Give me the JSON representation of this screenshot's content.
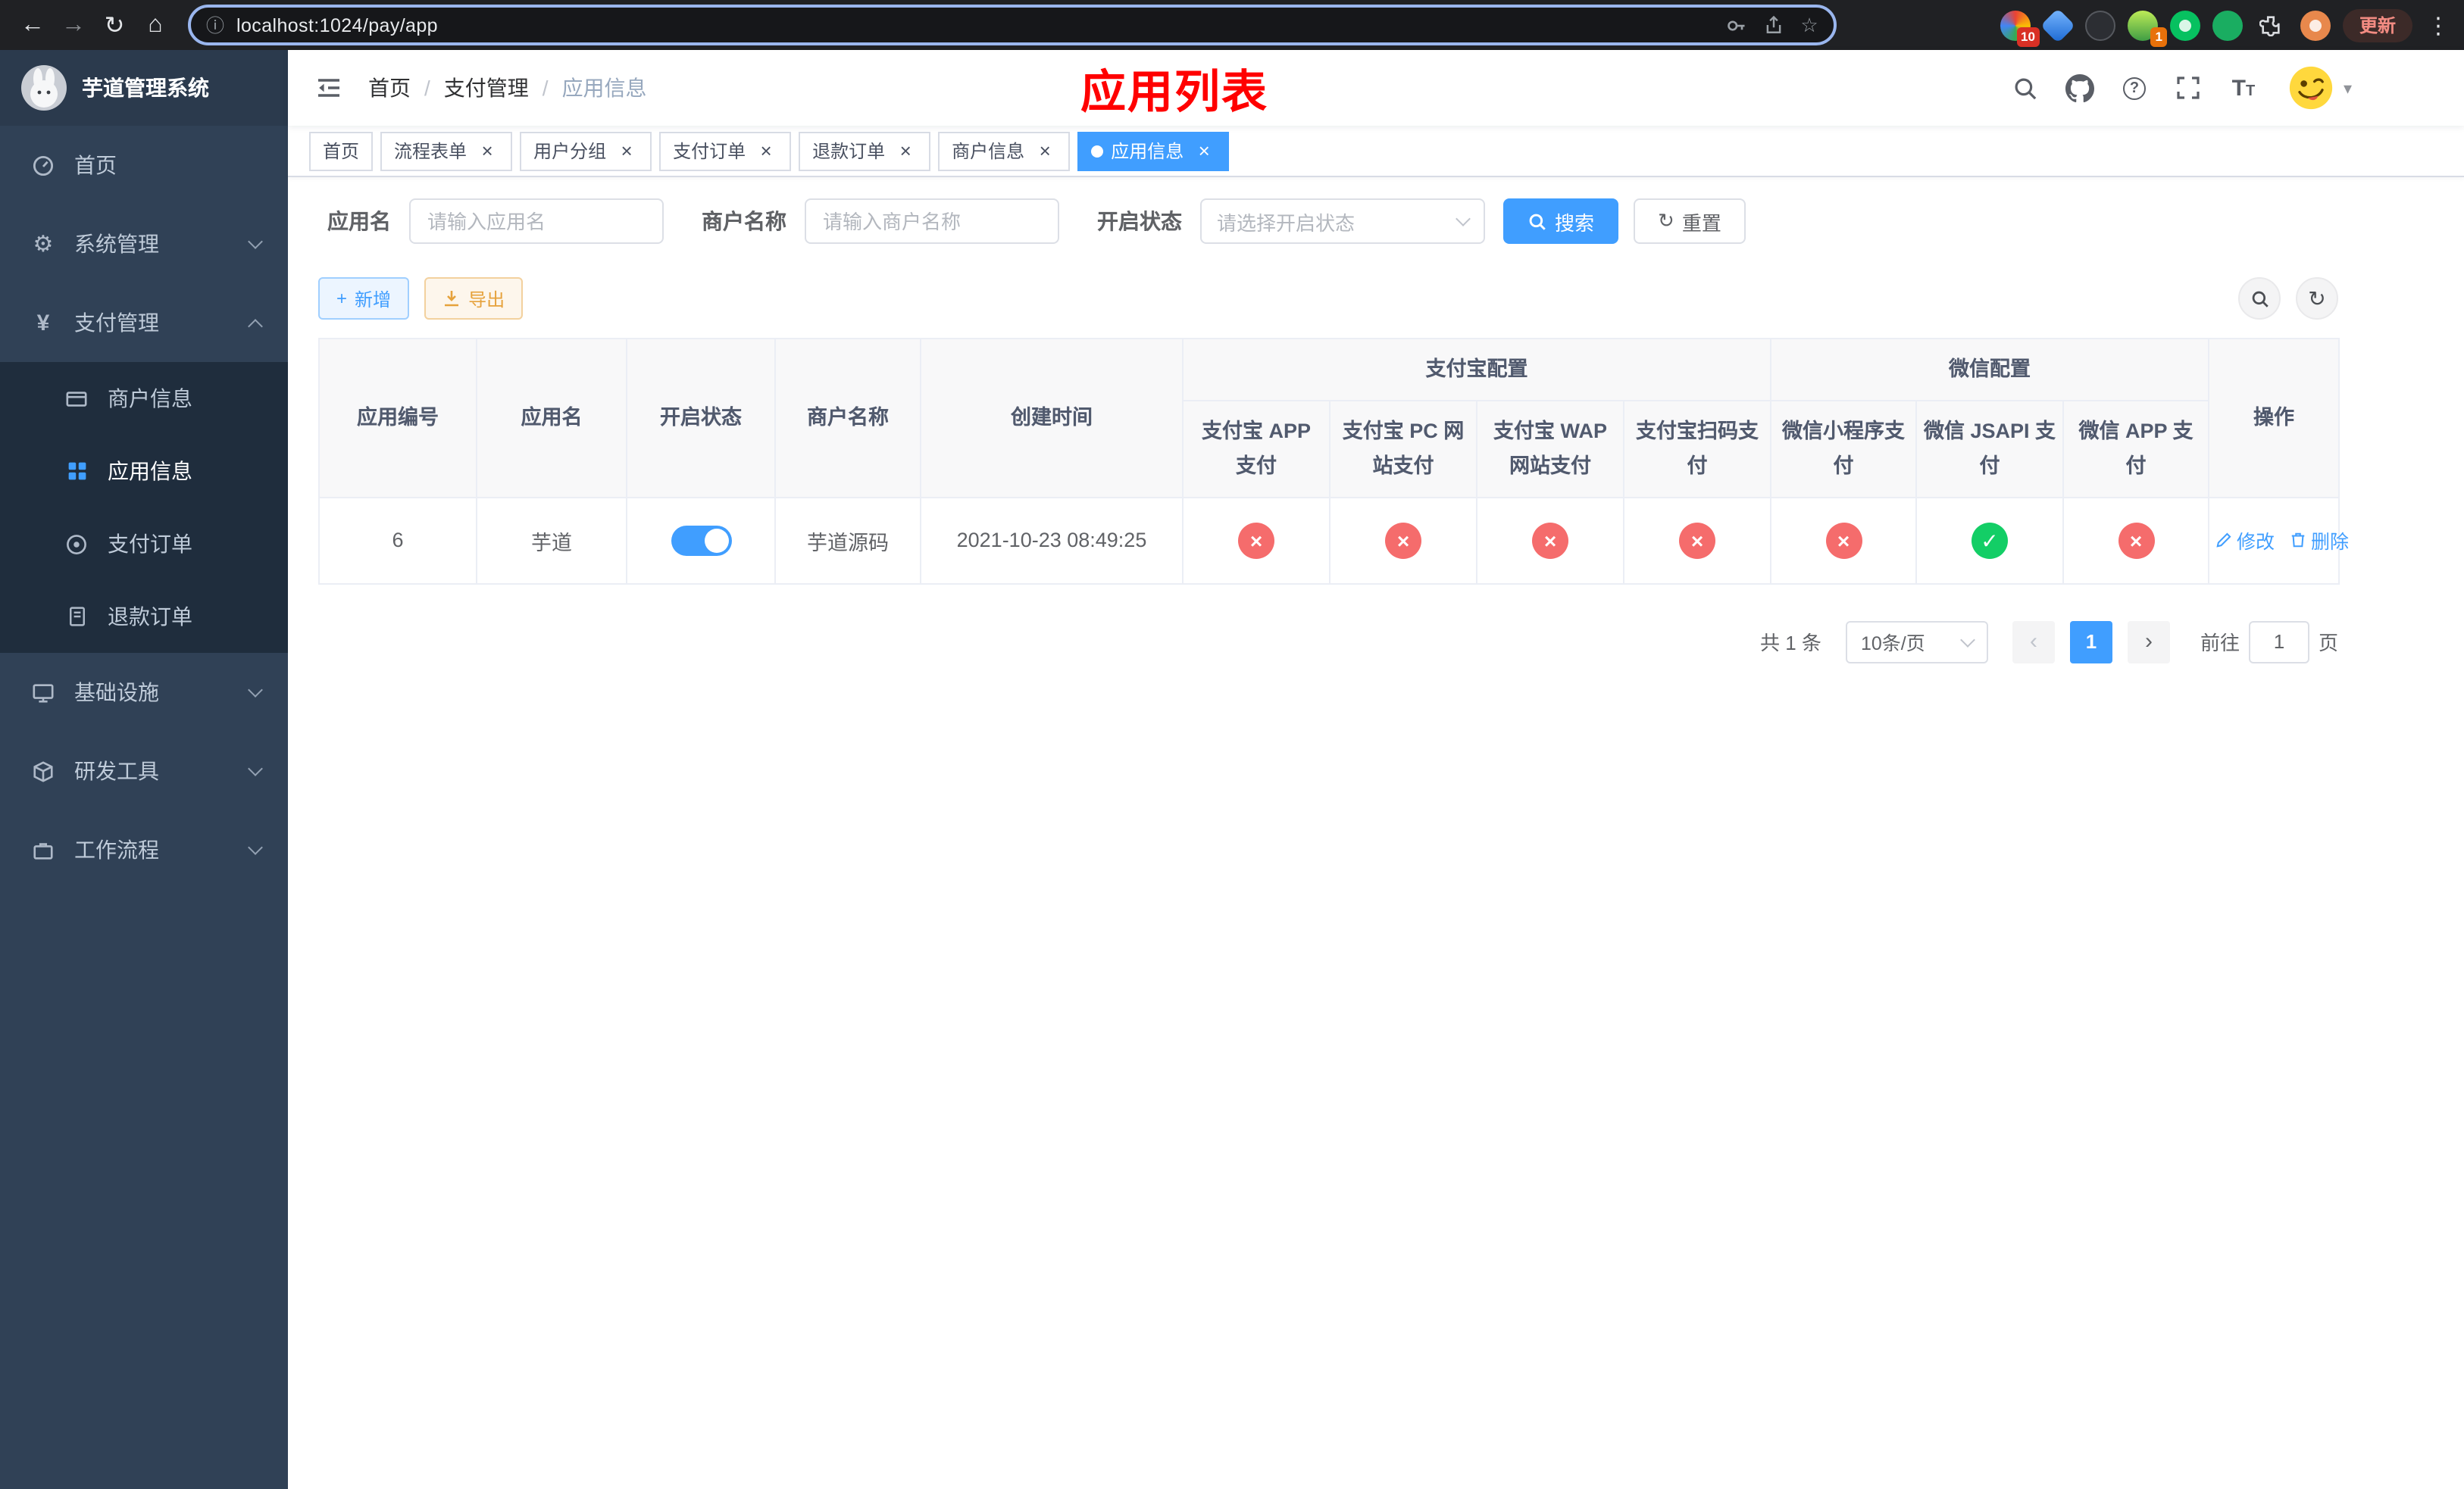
{
  "colors": {
    "primary": "#409eff",
    "success": "#13ce66",
    "danger": "#f56c6c",
    "warning": "#e6a23c",
    "title_red": "#ff0000",
    "sidebar_bg": "#304156",
    "submenu_bg": "#1f2d3d"
  },
  "glyphs": {
    "back": "←",
    "forward": "→",
    "reload": "↻",
    "home": "⌂",
    "info": "ⓘ",
    "star": "☆",
    "dots": "⋮",
    "close": "×",
    "check": "✓",
    "cross": "×",
    "prev": "‹",
    "next": "›",
    "plus": "+",
    "yen": "¥",
    "gear": "⚙",
    "question": "?",
    "slash": "/"
  },
  "browser": {
    "url": "localhost:1024/pay/app",
    "update_button": "更新",
    "ext_badge_a": "10",
    "ext_badge_b": "1"
  },
  "sidebar": {
    "title": "芋道管理系统",
    "items": [
      {
        "label": "首页"
      },
      {
        "label": "系统管理"
      },
      {
        "label": "支付管理",
        "children": [
          {
            "label": "商户信息"
          },
          {
            "label": "应用信息"
          },
          {
            "label": "支付订单"
          },
          {
            "label": "退款订单"
          }
        ]
      },
      {
        "label": "基础设施"
      },
      {
        "label": "研发工具"
      },
      {
        "label": "工作流程"
      }
    ]
  },
  "navbar": {
    "breadcrumb": [
      "首页",
      "支付管理",
      "应用信息"
    ],
    "page_title": "应用列表"
  },
  "tabs": [
    {
      "label": "首页"
    },
    {
      "label": "流程表单"
    },
    {
      "label": "用户分组"
    },
    {
      "label": "支付订单"
    },
    {
      "label": "退款订单"
    },
    {
      "label": "商户信息"
    },
    {
      "label": "应用信息"
    }
  ],
  "filters": {
    "app_name_label": "应用名",
    "app_name_placeholder": "请输入应用名",
    "merchant_label": "商户名称",
    "merchant_placeholder": "请输入商户名称",
    "status_label": "开启状态",
    "status_placeholder": "请选择开启状态",
    "search_button": "搜索",
    "reset_button": "重置"
  },
  "toolbar": {
    "add_button": "新增",
    "export_button": "导出"
  },
  "table": {
    "headers": {
      "app_id": "应用编号",
      "app_name": "应用名",
      "status": "开启状态",
      "merchant": "商户名称",
      "created": "创建时间",
      "alipay_group": "支付宝配置",
      "wechat_group": "微信配置",
      "alipay_app": "支付宝 APP 支付",
      "alipay_pc": "支付宝 PC 网站支付",
      "alipay_wap": "支付宝 WAP 网站支付",
      "alipay_qr": "支付宝扫码支付",
      "wechat_mini": "微信小程序支付",
      "wechat_jsapi": "微信 JSAPI 支付",
      "wechat_app": "微信 APP 支付",
      "actions": "操作"
    },
    "rows": [
      {
        "app_id": "6",
        "app_name": "芋道",
        "status_on": true,
        "merchant": "芋道源码",
        "created": "2021-10-23 08:49:25",
        "alipay_app": false,
        "alipay_pc": false,
        "alipay_wap": false,
        "alipay_qr": false,
        "wechat_mini": false,
        "wechat_jsapi": true,
        "wechat_app": false,
        "edit_link": "修改",
        "delete_link": "删除"
      }
    ]
  },
  "pagination": {
    "total_text": "共 1 条",
    "page_size": "10条/页",
    "current_page": "1",
    "goto_label": "前往",
    "goto_value": "1",
    "page_unit": "页"
  }
}
